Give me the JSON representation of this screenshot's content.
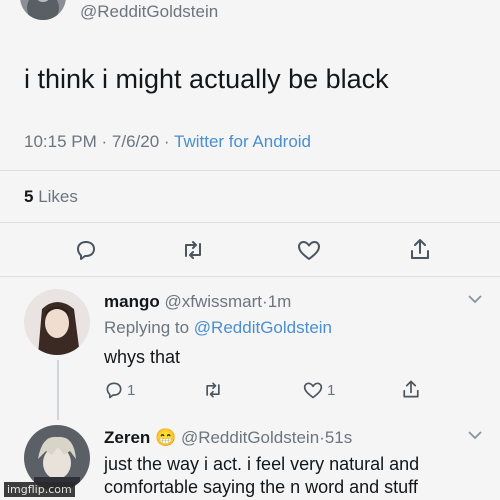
{
  "main_tweet": {
    "handle": "@RedditGoldstein",
    "text": "i think i might actually be black",
    "time": "10:15 PM",
    "date": "7/6/20",
    "source": "Twitter for Android",
    "likes_count": "5",
    "likes_label": "Likes",
    "separator": "·"
  },
  "replies": [
    {
      "display_name": "mango",
      "handle": "@xfwissmart",
      "age": "1m",
      "replying_prefix": "Replying to",
      "replying_to": "@RedditGoldstein",
      "text": "whys that",
      "reply_count": "1",
      "like_count": "1"
    },
    {
      "display_name": "Zeren",
      "emoji": "😁",
      "handle": "@RedditGoldstein",
      "age": "51s",
      "text_line1": "just the way i act. i feel very natural and",
      "text_line2": "comfortable saying the n word and stuff"
    }
  ],
  "watermark": "imgflip.com",
  "icons": [
    "reply-icon",
    "retweet-icon",
    "like-icon",
    "share-icon",
    "chevron-down-icon"
  ]
}
